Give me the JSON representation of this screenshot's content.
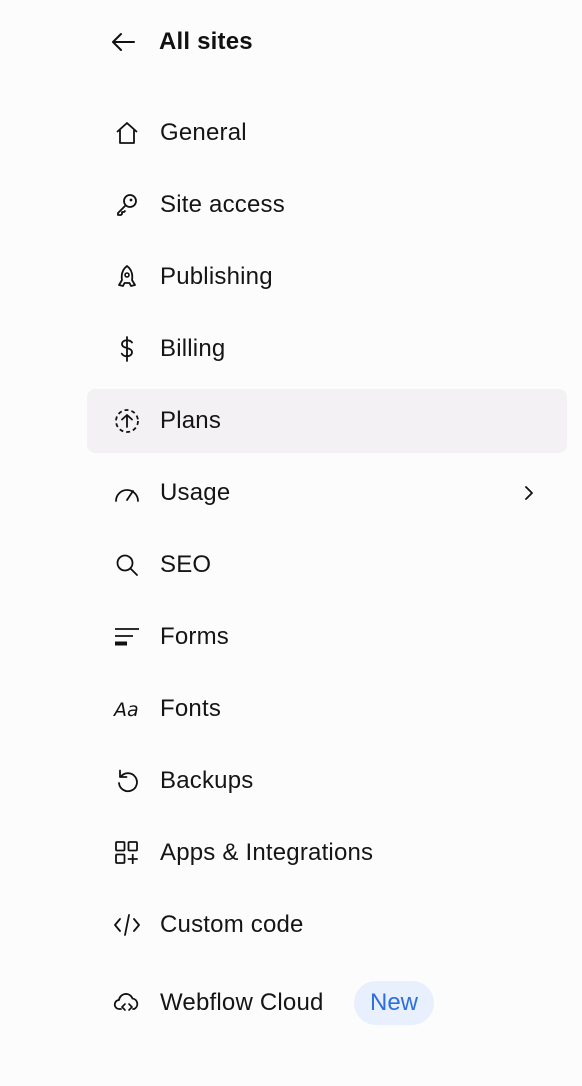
{
  "header": {
    "back_label": "All sites",
    "back_icon": "arrow-left-icon"
  },
  "menu": {
    "items": [
      {
        "label": "General",
        "icon": "home-icon"
      },
      {
        "label": "Site access",
        "icon": "key-icon"
      },
      {
        "label": "Publishing",
        "icon": "rocket-icon"
      },
      {
        "label": "Billing",
        "icon": "dollar-icon"
      },
      {
        "label": "Plans",
        "icon": "plan-upgrade-icon",
        "active": true
      },
      {
        "label": "Usage",
        "icon": "gauge-icon",
        "has_submenu": true
      },
      {
        "label": "SEO",
        "icon": "search-icon"
      },
      {
        "label": "Forms",
        "icon": "form-lines-icon"
      },
      {
        "label": "Fonts",
        "icon": "font-aa-icon"
      },
      {
        "label": "Backups",
        "icon": "restore-icon"
      },
      {
        "label": "Apps & Integrations",
        "icon": "apps-grid-icon"
      },
      {
        "label": "Custom code",
        "icon": "code-icon"
      },
      {
        "label": "Webflow Cloud",
        "icon": "cloud-code-icon",
        "badge": "New"
      }
    ]
  },
  "colors": {
    "active_bg": "#f3f1f4",
    "badge_bg": "#e8f0fd",
    "badge_text": "#2e6fe0",
    "text": "#151515"
  }
}
